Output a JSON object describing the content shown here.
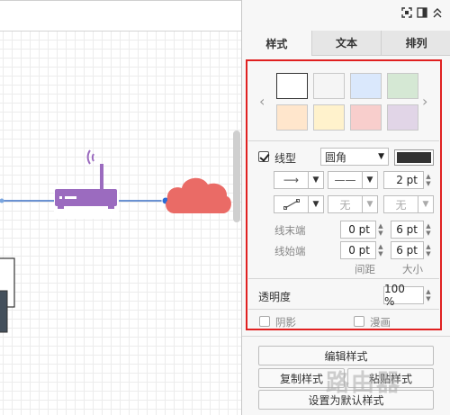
{
  "tabs": [
    {
      "label": "样式",
      "active": true
    },
    {
      "label": "文本",
      "active": false
    },
    {
      "label": "排列",
      "active": false
    }
  ],
  "swatches": [
    "#ffffff",
    "#f5f5f5",
    "#dae8fc",
    "#d5e8d4",
    "#ffe6cc",
    "#fff2cc",
    "#f8cecc",
    "#e1d5e7"
  ],
  "line": {
    "checkbox_label": "线型",
    "checked": true,
    "style_value": "圆角",
    "color": "#333333",
    "width_value": "2 pt",
    "endpoint_none_1": "无",
    "endpoint_none_2": "无"
  },
  "line_end": {
    "label": "线末端",
    "spacing": "0 pt",
    "size": "6 pt"
  },
  "line_start": {
    "label": "线始端",
    "spacing": "0 pt",
    "size": "6 pt"
  },
  "col_headers": {
    "spacing": "间距",
    "size": "大小"
  },
  "opacity": {
    "label": "透明度",
    "value": "100 %"
  },
  "shadow_label": "阴影",
  "sketch_label": "漫画",
  "buttons": {
    "edit_style": "编辑样式",
    "copy_style": "复制样式",
    "paste_style": "粘贴样式",
    "set_default": "设置为默认样式"
  },
  "diagram": {
    "router_color": "#9b6bbf",
    "cloud_color": "#ea6b66",
    "edge_color": "#3a6fc4"
  },
  "watermark": "路由器"
}
